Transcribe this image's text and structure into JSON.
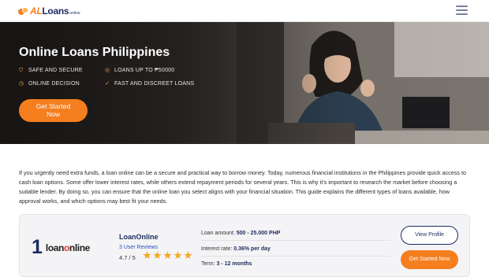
{
  "header": {
    "logo_al": "AL",
    "logo_loans": "Loans",
    "logo_online": "online",
    "menu_icon": "hamburger-menu-icon"
  },
  "hero": {
    "title": "Online Loans Philippines",
    "features": [
      {
        "label": "SAFE AND SECURE",
        "icon": "shield-icon"
      },
      {
        "label": "ONLINE DECISION",
        "icon": "clock-icon"
      },
      {
        "label": "LOANS UP TO ₱50000",
        "icon": "coins-icon"
      },
      {
        "label": "FAST AND DISCREET LOANS",
        "icon": "check-icon"
      }
    ],
    "cta_label_line1": "Get Started",
    "cta_label_line2": "Now"
  },
  "intro": {
    "text": "If you urgently need extra funds, a loan online can be a secure and practical way to borrow money. Today, numerous financial institutions in the Philippines provide quick access to cash loan options. Some offer lower interest rates, while others extend repayment periods for several years. This is why it's important to research the market before choosing a suitable lender. By doing so, you can ensure that the online loan you select aligns with your financial situation. This guide explains the different types of loans available, how approval works, and which options may best fit your needs."
  },
  "lender": {
    "rank": "1",
    "brand_loan": "loan",
    "brand_o": "o",
    "brand_nline": "nline",
    "name": "LoanOnline",
    "reviews": "3 User Reviews",
    "rating_text": "4.7 / 5",
    "stars": 5,
    "loan_amount_label": "Loan amount:",
    "loan_amount_value": "500 - 25.000 PHP",
    "interest_label": "Interest rate:",
    "interest_value": "0.36% per day",
    "term_label": "Term:",
    "term_value": "3 - 12 months",
    "view_profile": "View Profile",
    "get_started": "Get Started Now"
  },
  "colors": {
    "accent": "#f57e1f",
    "navy": "#1d2b5f",
    "star": "#f5a623"
  }
}
